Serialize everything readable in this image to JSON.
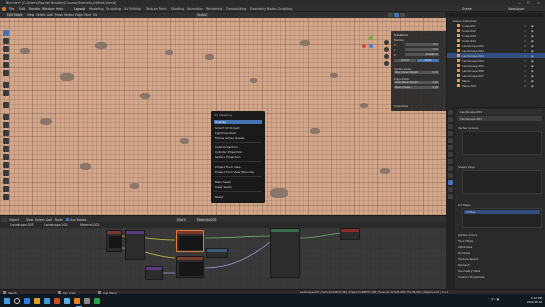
{
  "window": {
    "title": "Blender* [C:\\Users\\Rachel Bradley\\Course\\Scenes\\untitled.blend]",
    "controls": [
      "—",
      "☐",
      "✕"
    ]
  },
  "menubar": {
    "items": [
      "File",
      "Edit",
      "Render",
      "Window",
      "Help"
    ],
    "workspaces": [
      "Layout",
      "Modeling",
      "Sculpting",
      "UV Editing",
      "Texture Paint",
      "Shading",
      "Animation",
      "Rendering",
      "Compositing",
      "Geometry Nodes",
      "Scripting"
    ],
    "active_workspace": "Layout",
    "scene_label": "Scene",
    "view_layer_label": "ViewLayer"
  },
  "viewport_header": {
    "mode": "Edit Mode",
    "menus": [
      "View",
      "Select",
      "Add",
      "Mesh",
      "Vertex",
      "Edge",
      "Face",
      "UV"
    ],
    "transform": "Global"
  },
  "n_panel": {
    "title": "Transform",
    "median_label": "Median:",
    "fields": [
      {
        "label": "X",
        "value": "0 m"
      },
      {
        "label": "Y",
        "value": "0 m"
      },
      {
        "label": "Z",
        "value": "-0.0262 m"
      }
    ],
    "toggle_global": "Global",
    "toggle_local": "Local",
    "vertex_weights_label": "Vertex Data:",
    "mean_bevel_weight": "Mean Bevel Weight",
    "mean_bevel_value": "0.00",
    "edge_data_label": "Edge Data:",
    "edge_rows": [
      {
        "label": "Mean Bevel Weight",
        "value": "0.00"
      },
      {
        "label": "Mean Crease",
        "value": "0.00"
      }
    ],
    "properties_label": "Properties"
  },
  "uv_menu": {
    "title": "UV Mapping",
    "items": [
      "Unwrap",
      "Smart UV Project",
      "Lightmap Pack",
      "Follow Active Quads",
      "Cube Projection",
      "Cylinder Projection",
      "Sphere Projection",
      "Project From View",
      "Project from View (Bounds)",
      "Mark Seam",
      "Clear Seam",
      "Reset"
    ],
    "highlighted": "Unwrap"
  },
  "outliner": {
    "rows": [
      {
        "label": "Scene Collection",
        "selected": false
      },
      {
        "label": "Cube.001",
        "selected": false
      },
      {
        "label": "Cube.002",
        "selected": false
      },
      {
        "label": "Cube.003",
        "selected": false
      },
      {
        "label": "Cube.004",
        "selected": false
      },
      {
        "label": "Landscape.001",
        "selected": false
      },
      {
        "label": "Landscape.002",
        "selected": false
      },
      {
        "label": "Landscape.003",
        "selected": true
      },
      {
        "label": "Landscape.004",
        "selected": false
      },
      {
        "label": "Landscape.005",
        "selected": false
      },
      {
        "label": "Landscape.006",
        "selected": false
      },
      {
        "label": "Landscape.007",
        "selected": false
      },
      {
        "label": "Plane",
        "selected": false
      },
      {
        "label": "Plane.001",
        "selected": false
      }
    ]
  },
  "properties": {
    "object_name": "Landscape.003",
    "data_name": "Landscape.003",
    "sections": [
      "Vertex Groups",
      "Shape Keys",
      "UV Maps",
      "Vertex Colors",
      "Face Maps",
      "Attributes",
      "Normals",
      "Texture Space",
      "Remesh",
      "Geometry Data",
      "Custom Properties"
    ],
    "uv_map_name": "UVMap"
  },
  "node_editor": {
    "header_items": [
      "Object",
      "View",
      "Select",
      "Add",
      "Node",
      "Use Nodes"
    ],
    "slot": "Slot 1",
    "material": "Material.003",
    "breadcrumb": [
      "Landscape.003",
      "Landscape.003",
      "Material.003"
    ]
  },
  "statusbar": {
    "left": [
      "Select",
      "Pan View",
      "Call Menu"
    ],
    "right": "Landscape.003 | Verts:20,649/41,964 | Edges:51,888/72,168 | Faces:21,222/28,448 | Tris:66,000 | Objects:1/22 | 3.2.1"
  },
  "taskbar": {
    "time": "4:12 PM",
    "date": "2022-08-18",
    "icon_colors": [
      "#2a7de1",
      "#e6a020",
      "#3aa0d8",
      "#d04a2a",
      "#5bb0e8",
      "#e87d22",
      "#888888",
      "#2ba54a"
    ]
  }
}
